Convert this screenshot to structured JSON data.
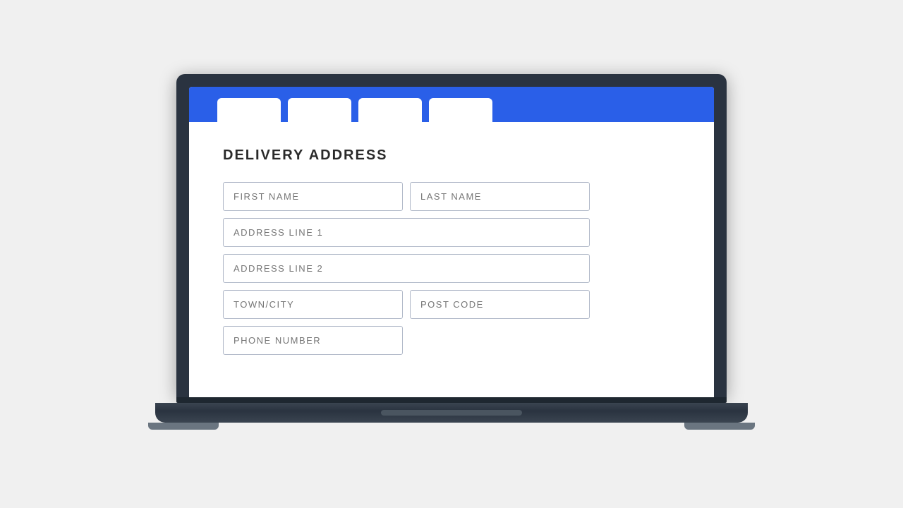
{
  "page": {
    "title": "DELIVERY ADDRESS",
    "background_color": "#f0f0f0"
  },
  "browser": {
    "bar_color": "#2a5fe8",
    "tabs": [
      {
        "id": "tab1",
        "label": ""
      },
      {
        "id": "tab2",
        "label": ""
      },
      {
        "id": "tab3",
        "label": ""
      },
      {
        "id": "tab4",
        "label": ""
      }
    ]
  },
  "form": {
    "fields": {
      "first_name": {
        "placeholder": "FIRST NAME"
      },
      "last_name": {
        "placeholder": "LAST NAME"
      },
      "address_line_1": {
        "placeholder": "ADDRESS LINE 1"
      },
      "address_line_2": {
        "placeholder": "ADDRESS LINE 2"
      },
      "town_city": {
        "placeholder": "TOWN/CITY"
      },
      "post_code": {
        "placeholder": "POST CODE"
      },
      "phone_number": {
        "placeholder": "PHONE NUMBER"
      }
    }
  }
}
